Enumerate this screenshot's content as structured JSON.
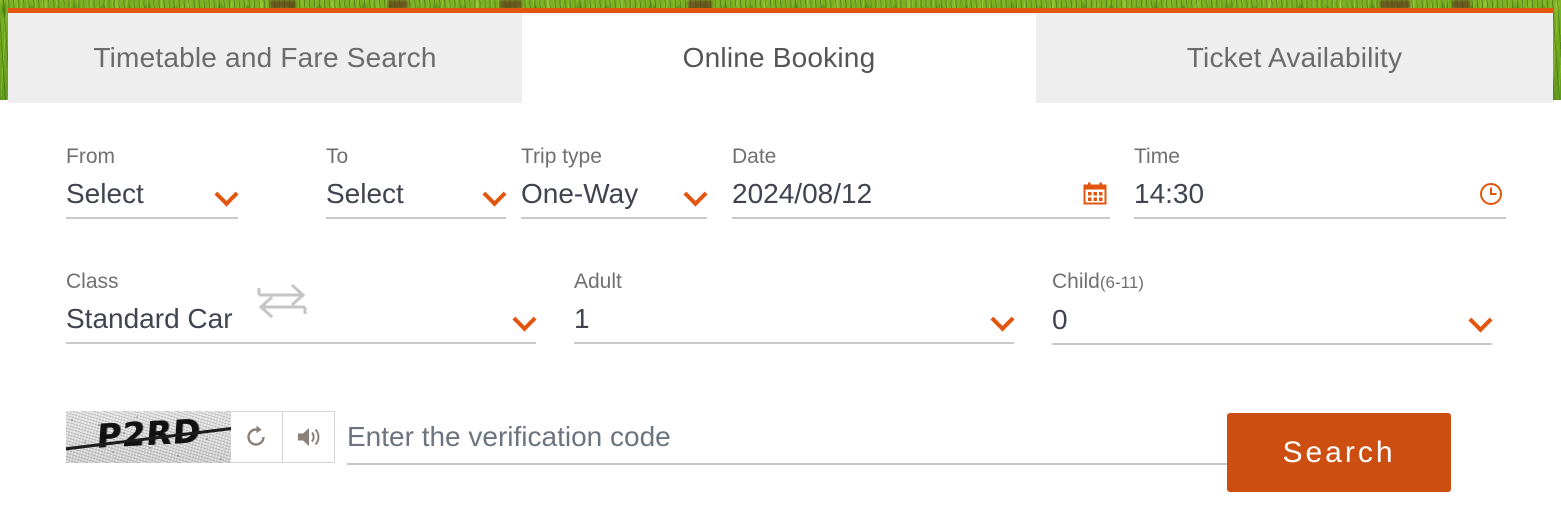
{
  "window": {
    "accent_orange": "#e2550e",
    "button_orange": "#cc4e11",
    "tab_inactive_bg": "#eeeeee",
    "backdrop": "grass-photo"
  },
  "tabs": [
    {
      "label": "Timetable and Fare Search",
      "active": false
    },
    {
      "label": "Online Booking",
      "active": true
    },
    {
      "label": "Ticket Availability",
      "active": false
    }
  ],
  "form": {
    "from": {
      "label": "From",
      "value": "Select"
    },
    "swap": {
      "icon": "swap-arrows-icon"
    },
    "to": {
      "label": "To",
      "value": "Select"
    },
    "trip_type": {
      "label": "Trip type",
      "value": "One-Way"
    },
    "date": {
      "label": "Date",
      "value": "2024/08/12",
      "icon": "calendar-icon"
    },
    "time": {
      "label": "Time",
      "value": "14:30",
      "icon": "clock-icon"
    },
    "class": {
      "label": "Class",
      "value": "Standard Car"
    },
    "adult": {
      "label": "Adult",
      "value": "1"
    },
    "child": {
      "label": "Child",
      "label_sub": "(6-11)",
      "value": "0"
    }
  },
  "captcha": {
    "image_text": "P2RD",
    "refresh_icon": "refresh-icon",
    "audio_icon": "speaker-icon",
    "input_placeholder": "Enter the verification code",
    "input_value": ""
  },
  "actions": {
    "search_label": "Search"
  }
}
